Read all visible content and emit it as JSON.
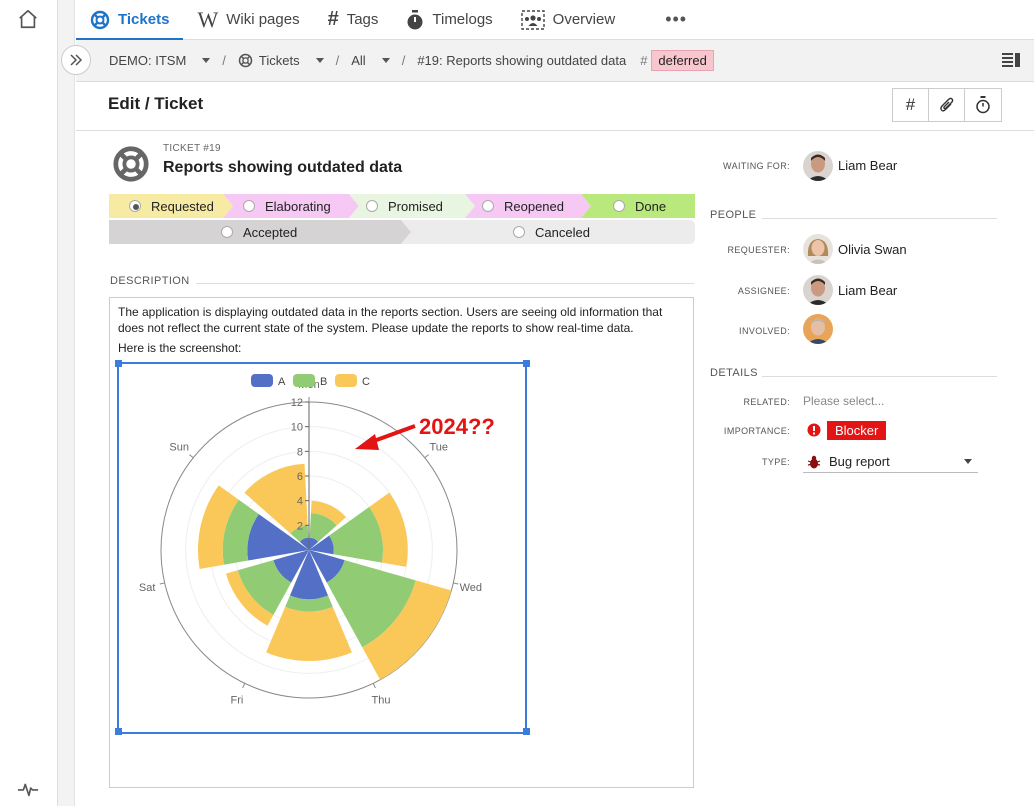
{
  "nav": {
    "tabs": [
      {
        "label": "Tickets",
        "icon": "lifebuoy-icon",
        "active": true
      },
      {
        "label": "Wiki pages",
        "icon": "wikipedia-icon"
      },
      {
        "label": "Tags",
        "icon": "hash-icon"
      },
      {
        "label": "Timelogs",
        "icon": "stopwatch-icon"
      },
      {
        "label": "Overview",
        "icon": "group-icon"
      }
    ],
    "more": "•••"
  },
  "breadcrumb": {
    "project": "DEMO: ITSM",
    "tickets": "Tickets",
    "sep": "/",
    "filter": "All",
    "ticket": "#19: Reports showing outdated data",
    "hash": "#",
    "tag": "deferred"
  },
  "header": {
    "title": "Edit / Ticket"
  },
  "ticket": {
    "number": "TICKET #19",
    "title": "Reports showing outdated data"
  },
  "workflow": {
    "row1": [
      {
        "label": "Requested",
        "color": "#f7eba4",
        "selected": true
      },
      {
        "label": "Elaborating",
        "color": "#f6c9f4"
      },
      {
        "label": "Promised",
        "color": "#e8f5e0"
      },
      {
        "label": "Reopened",
        "color": "#f6c9f4"
      },
      {
        "label": "Done",
        "color": "#b9e87c"
      }
    ],
    "row2": [
      {
        "label": "Accepted",
        "color": "#d5d3d3"
      },
      {
        "label": "Canceled",
        "color": "#ececec"
      }
    ]
  },
  "description": {
    "label": "DESCRIPTION",
    "text": "The application is displaying outdated data in the reports section. Users are seeing old information that does not reflect the current state of the system. Please update the reports to show real-time data.",
    "text2": "Here is the screenshot:"
  },
  "chart_data": {
    "type": "polar-stacked-bar",
    "categories": [
      "Mon",
      "Tue",
      "Wed",
      "Thu",
      "Fri",
      "Sat",
      "Sun"
    ],
    "series": [
      {
        "name": "A",
        "color": "#5470c6",
        "values": [
          1,
          2,
          3,
          4,
          3,
          5,
          1
        ]
      },
      {
        "name": "B",
        "color": "#91cc75",
        "values": [
          2,
          4,
          6,
          1,
          3,
          2,
          1
        ]
      },
      {
        "name": "C",
        "color": "#fac858",
        "values": [
          1,
          2,
          3,
          4,
          1,
          2,
          5
        ]
      }
    ],
    "radial_ticks": [
      "2",
      "4",
      "6",
      "8",
      "10",
      "12"
    ],
    "radial_max": 12,
    "annotation": "2024??"
  },
  "panel": {
    "waiting_label": "WAITING FOR:",
    "waiting_name": "Liam Bear",
    "people_label": "PEOPLE",
    "requester_label": "REQUESTER:",
    "requester_name": "Olivia Swan",
    "assignee_label": "ASSIGNEE:",
    "assignee_name": "Liam Bear",
    "involved_label": "INVOLVED:",
    "details_label": "DETAILS",
    "related_label": "RELATED:",
    "related_placeholder": "Please select...",
    "importance_label": "IMPORTANCE:",
    "importance_value": "Blocker",
    "type_label": "TYPE:",
    "type_value": "Bug report"
  }
}
